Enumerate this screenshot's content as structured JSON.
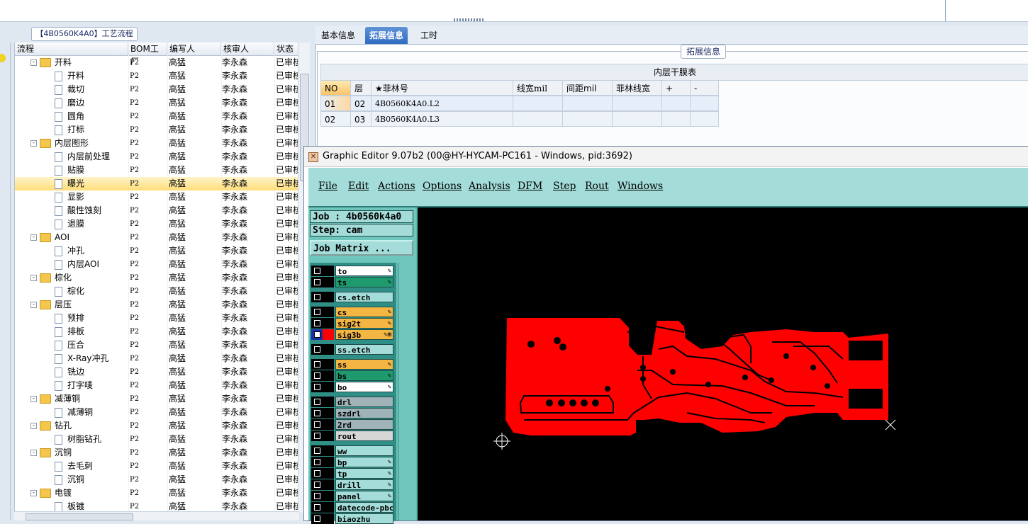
{
  "left_panel": {
    "tab_label": "【4B0560K4A0】工艺流程",
    "columns": [
      "流程",
      "BOM工厂",
      "编写人",
      "核审人",
      "状态"
    ],
    "rows": [
      {
        "level": 0,
        "name": "开料",
        "bom": "P2",
        "writer": "高猛",
        "reviewer": "李永森",
        "status": "已审核"
      },
      {
        "level": 1,
        "name": "开料",
        "bom": "P2",
        "writer": "高猛",
        "reviewer": "李永森",
        "status": "已审核"
      },
      {
        "level": 1,
        "name": "裁切",
        "bom": "P2",
        "writer": "高猛",
        "reviewer": "李永森",
        "status": "已审核"
      },
      {
        "level": 1,
        "name": "磨边",
        "bom": "P2",
        "writer": "高猛",
        "reviewer": "李永森",
        "status": "已审核"
      },
      {
        "level": 1,
        "name": "圆角",
        "bom": "P2",
        "writer": "高猛",
        "reviewer": "李永森",
        "status": "已审核"
      },
      {
        "level": 1,
        "name": "打标",
        "bom": "P2",
        "writer": "高猛",
        "reviewer": "李永森",
        "status": "已审核"
      },
      {
        "level": 0,
        "name": "内层图形",
        "bom": "P2",
        "writer": "高猛",
        "reviewer": "李永森",
        "status": "已审核"
      },
      {
        "level": 1,
        "name": "内层前处理",
        "bom": "P2",
        "writer": "高猛",
        "reviewer": "李永森",
        "status": "已审核"
      },
      {
        "level": 1,
        "name": "贴膜",
        "bom": "P2",
        "writer": "高猛",
        "reviewer": "李永森",
        "status": "已审核"
      },
      {
        "level": 1,
        "name": "曝光",
        "bom": "P2",
        "writer": "高猛",
        "reviewer": "李永森",
        "status": "已审核",
        "selected": true
      },
      {
        "level": 1,
        "name": "显影",
        "bom": "P2",
        "writer": "高猛",
        "reviewer": "李永森",
        "status": "已审核"
      },
      {
        "level": 1,
        "name": "酸性蚀刻",
        "bom": "P2",
        "writer": "高猛",
        "reviewer": "李永森",
        "status": "已审核"
      },
      {
        "level": 1,
        "name": "退膜",
        "bom": "P2",
        "writer": "高猛",
        "reviewer": "李永森",
        "status": "已审核"
      },
      {
        "level": 0,
        "name": "AOI",
        "bom": "P2",
        "writer": "高猛",
        "reviewer": "李永森",
        "status": "已审核"
      },
      {
        "level": 1,
        "name": "冲孔",
        "bom": "P2",
        "writer": "高猛",
        "reviewer": "李永森",
        "status": "已审核"
      },
      {
        "level": 1,
        "name": "内层AOI",
        "bom": "P2",
        "writer": "高猛",
        "reviewer": "李永森",
        "status": "已审核"
      },
      {
        "level": 0,
        "name": "棕化",
        "bom": "P2",
        "writer": "高猛",
        "reviewer": "李永森",
        "status": "已审核"
      },
      {
        "level": 1,
        "name": "棕化",
        "bom": "P2",
        "writer": "高猛",
        "reviewer": "李永森",
        "status": "已审核"
      },
      {
        "level": 0,
        "name": "层压",
        "bom": "P2",
        "writer": "高猛",
        "reviewer": "李永森",
        "status": "已审核"
      },
      {
        "level": 1,
        "name": "预排",
        "bom": "P2",
        "writer": "高猛",
        "reviewer": "李永森",
        "status": "已审核"
      },
      {
        "level": 1,
        "name": "排板",
        "bom": "P2",
        "writer": "高猛",
        "reviewer": "李永森",
        "status": "已审核"
      },
      {
        "level": 1,
        "name": "压合",
        "bom": "P2",
        "writer": "高猛",
        "reviewer": "李永森",
        "status": "已审核"
      },
      {
        "level": 1,
        "name": "X-Ray冲孔",
        "bom": "P2",
        "writer": "高猛",
        "reviewer": "李永森",
        "status": "已审核"
      },
      {
        "level": 1,
        "name": "铣边",
        "bom": "P2",
        "writer": "高猛",
        "reviewer": "李永森",
        "status": "已审核"
      },
      {
        "level": 1,
        "name": "打字唛",
        "bom": "P2",
        "writer": "高猛",
        "reviewer": "李永森",
        "status": "已审核"
      },
      {
        "level": 0,
        "name": "减薄铜",
        "bom": "P2",
        "writer": "高猛",
        "reviewer": "李永森",
        "status": "已审核"
      },
      {
        "level": 1,
        "name": "减薄铜",
        "bom": "P2",
        "writer": "高猛",
        "reviewer": "李永森",
        "status": "已审核"
      },
      {
        "level": 0,
        "name": "钻孔",
        "bom": "P2",
        "writer": "高猛",
        "reviewer": "李永森",
        "status": "已审核"
      },
      {
        "level": 1,
        "name": "树脂钻孔",
        "bom": "P2",
        "writer": "高猛",
        "reviewer": "李永森",
        "status": "已审核"
      },
      {
        "level": 0,
        "name": "沉铜",
        "bom": "P2",
        "writer": "高猛",
        "reviewer": "李永森",
        "status": "已审核"
      },
      {
        "level": 1,
        "name": "去毛刺",
        "bom": "P2",
        "writer": "高猛",
        "reviewer": "李永森",
        "status": "已审核"
      },
      {
        "level": 1,
        "name": "沉铜",
        "bom": "P2",
        "writer": "高猛",
        "reviewer": "李永森",
        "status": "已审核"
      },
      {
        "level": 0,
        "name": "电镀",
        "bom": "P2",
        "writer": "高猛",
        "reviewer": "李永森",
        "status": "已审核"
      },
      {
        "level": 1,
        "name": "板镀",
        "bom": "P2",
        "writer": "高猛",
        "reviewer": "李永森",
        "status": "已审核"
      }
    ]
  },
  "right_panel": {
    "tabs": [
      {
        "label": "基本信息",
        "active": false
      },
      {
        "label": "拓展信息",
        "active": true
      },
      {
        "label": "工时",
        "active": false
      }
    ],
    "section_label": "拓展信息",
    "table_title": "内层干膜表",
    "table_columns": [
      "NO",
      "层",
      "★菲林号",
      "线宽mil",
      "间距mil",
      "菲林线宽",
      "+",
      "-"
    ],
    "table_rows": [
      [
        "01",
        "02",
        "4B0560K4A0.L2",
        "",
        "",
        "",
        "",
        ""
      ],
      [
        "02",
        "03",
        "4B0560K4A0.L3",
        "",
        "",
        "",
        "",
        ""
      ]
    ]
  },
  "graphic_editor": {
    "title": "Graphic Editor 9.07b2 (00@HY-HYCAM-PC161 - Windows, pid:3692)",
    "menus": [
      "File",
      "Edit",
      "Actions",
      "Options",
      "Analysis",
      "DFM",
      "Step",
      "Rout",
      "Windows"
    ],
    "job_label": "Job : 4b0560k4a0",
    "step_label": "Step: cam",
    "matrix_button": "Job Matrix ...",
    "layers": [
      {
        "name": "to",
        "color": "#ffffff",
        "mark": "✎"
      },
      {
        "name": "ts",
        "color": "#1f9a6e",
        "mark": "✎"
      },
      {
        "name": "cs.etch",
        "color": "#a3dcd8",
        "mark": ""
      },
      {
        "name": "cs",
        "color": "#f4b642",
        "mark": "✎"
      },
      {
        "name": "sig2t",
        "color": "#f4b642",
        "mark": "✎"
      },
      {
        "name": "sig3b",
        "color": "#f4b642",
        "mark": "✎⊞",
        "active": true
      },
      {
        "name": "ss.etch",
        "color": "#a3dcd8",
        "mark": ""
      },
      {
        "name": "ss",
        "color": "#f4b642",
        "mark": "✎"
      },
      {
        "name": "bs",
        "color": "#1f9a6e",
        "mark": "✎"
      },
      {
        "name": "bo",
        "color": "#ffffff",
        "mark": "✎"
      },
      {
        "name": "drl",
        "color": "#9fb3b9",
        "mark": ""
      },
      {
        "name": "szdrl",
        "color": "#9fb3b9",
        "mark": ""
      },
      {
        "name": "2rd",
        "color": "#9fb3b9",
        "mark": ""
      },
      {
        "name": "rout",
        "color": "#d6d6d6",
        "mark": ""
      },
      {
        "name": "ww",
        "color": "#a3dcd8",
        "mark": ""
      },
      {
        "name": "bp",
        "color": "#a3dcd8",
        "mark": "✎"
      },
      {
        "name": "tp",
        "color": "#a3dcd8",
        "mark": "✎"
      },
      {
        "name": "drill",
        "color": "#a3dcd8",
        "mark": "✎"
      },
      {
        "name": "panel",
        "color": "#a3dcd8",
        "mark": "✎"
      },
      {
        "name": "datecode-pbc",
        "color": "#a3dcd8",
        "mark": ""
      },
      {
        "name": "biaozhu",
        "color": "#a3dcd8",
        "mark": ""
      }
    ]
  }
}
